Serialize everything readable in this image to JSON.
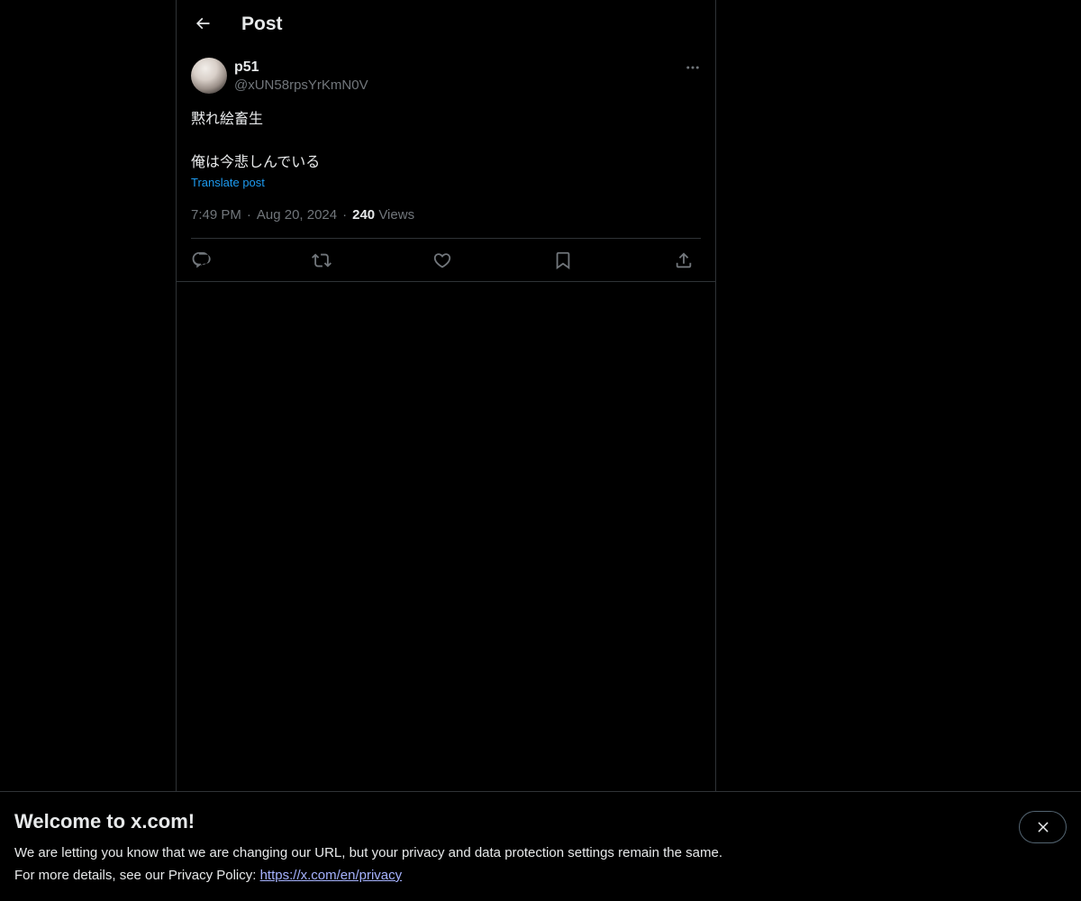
{
  "header": {
    "title": "Post"
  },
  "post": {
    "author": {
      "display_name": "p51",
      "handle": "@xUN58rpsYrKmN0V"
    },
    "text_lines": [
      "黙れ絵畜生",
      "",
      "俺は今悲しんでいる"
    ],
    "translate_label": "Translate post",
    "time": "7:49 PM",
    "date": "Aug 20, 2024",
    "separator": "·",
    "views_count": "240",
    "views_label": "Views"
  },
  "actions": [
    {
      "name": "reply",
      "icon": "reply-icon"
    },
    {
      "name": "repost",
      "icon": "repost-icon"
    },
    {
      "name": "like",
      "icon": "like-icon"
    },
    {
      "name": "bookmark",
      "icon": "bookmark-icon"
    },
    {
      "name": "share",
      "icon": "share-icon"
    }
  ],
  "banner": {
    "title": "Welcome to x.com!",
    "line1": "We are letting you know that we are changing our URL, but your privacy and data protection settings remain the same.",
    "line2_prefix": "For more details, see our Privacy Policy: ",
    "link_text": "https://x.com/en/privacy"
  },
  "colors": {
    "background": "#000000",
    "text_primary": "#e7e9ea",
    "text_secondary": "#71767b",
    "accent": "#1d9bf0",
    "border": "#2f3336",
    "link": "#a6b3ff"
  }
}
